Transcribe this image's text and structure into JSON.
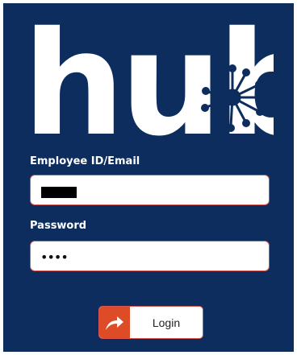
{
  "logo": {
    "text": "hub",
    "color": "#ffffff",
    "icon": "network-hub-icon"
  },
  "form": {
    "user": {
      "label": "Employee ID/Email",
      "value": ""
    },
    "password": {
      "label": "Password",
      "masked_value": "••••"
    }
  },
  "actions": {
    "login_label": "Login",
    "login_icon": "share-arrow-icon"
  },
  "colors": {
    "background": "#0c2d5d",
    "accent": "#dd4b27",
    "field_border": "#d9534f"
  }
}
